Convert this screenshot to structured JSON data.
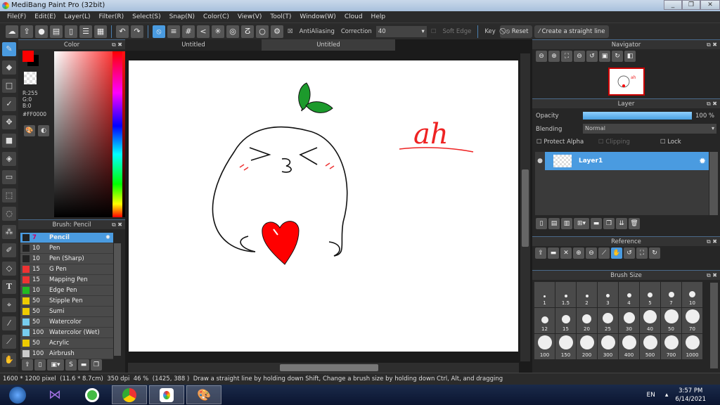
{
  "window": {
    "title": "MediBang Paint Pro (32bit)"
  },
  "menu": [
    "File(F)",
    "Edit(E)",
    "Layer(L)",
    "Filter(R)",
    "Select(S)",
    "Snap(N)",
    "Color(C)",
    "View(V)",
    "Tool(T)",
    "Window(W)",
    "Cloud",
    "Help"
  ],
  "toolbar": {
    "antialiasing": "AntiAliasing",
    "antialiasing_checked": true,
    "correction_label": "Correction",
    "correction_value": "40",
    "soft_edge": "Soft Edge",
    "key_label": "Key",
    "reset": "Reset",
    "straight_line": "Create a straight line"
  },
  "color": {
    "title": "Color",
    "primary": "#FF0000",
    "secondary": "#000000",
    "r": "R:255",
    "g": "G:0",
    "b": "B:0",
    "hex": "#FF0000"
  },
  "brush": {
    "title": "Brush: Pencil",
    "items": [
      {
        "size": "7",
        "name": "Pencil",
        "color": "#222222",
        "selected": true
      },
      {
        "size": "10",
        "name": "Pen",
        "color": "#222222"
      },
      {
        "size": "10",
        "name": "Pen (Sharp)",
        "color": "#222222"
      },
      {
        "size": "15",
        "name": "G Pen",
        "color": "#ee3333"
      },
      {
        "size": "15",
        "name": "Mapping Pen",
        "color": "#ee3333"
      },
      {
        "size": "10",
        "name": "Edge Pen",
        "color": "#22bb22"
      },
      {
        "size": "50",
        "name": "Stipple Pen",
        "color": "#eecc00"
      },
      {
        "size": "50",
        "name": "Sumi",
        "color": "#eecc00"
      },
      {
        "size": "50",
        "name": "Watercolor",
        "color": "#77ccee"
      },
      {
        "size": "100",
        "name": "Watercolor (Wet)",
        "color": "#77ccee"
      },
      {
        "size": "50",
        "name": "Acrylic",
        "color": "#eecc00"
      },
      {
        "size": "100",
        "name": "Airbrush",
        "color": "#cccccc"
      }
    ]
  },
  "tabs": [
    "Untitled",
    "Untitled"
  ],
  "canvas": {
    "text": "ah"
  },
  "navigator": {
    "title": "Navigator"
  },
  "layer": {
    "title": "Layer",
    "opacity_label": "Opacity",
    "opacity_value": "100 %",
    "opacity": 1.0,
    "blending_label": "Blending",
    "blending_value": "Normal",
    "protect_alpha": "Protect Alpha",
    "clipping": "Clipping",
    "lock": "Lock",
    "layers": [
      {
        "name": "Layer1"
      }
    ]
  },
  "reference": {
    "title": "Reference"
  },
  "brush_size": {
    "title": "Brush Size",
    "sizes": [
      "1",
      "1.5",
      "2",
      "3",
      "4",
      "5",
      "7",
      "10",
      "12",
      "15",
      "20",
      "25",
      "30",
      "40",
      "50",
      "70",
      "100",
      "150",
      "200",
      "300",
      "400",
      "500",
      "700",
      "1000"
    ]
  },
  "status": {
    "dims": "1600 * 1200 pixel",
    "cm": "(11.6 * 8.7cm)",
    "dpi": "350 dpi",
    "zoom": "46 %",
    "coords": "(1425, 388 )",
    "hint": "Draw a straight line by holding down Shift, Change a brush size by holding down Ctrl, Alt, and dragging"
  },
  "taskbar": {
    "lang": "EN",
    "time": "3:57 PM",
    "date": "6/14/2021"
  }
}
